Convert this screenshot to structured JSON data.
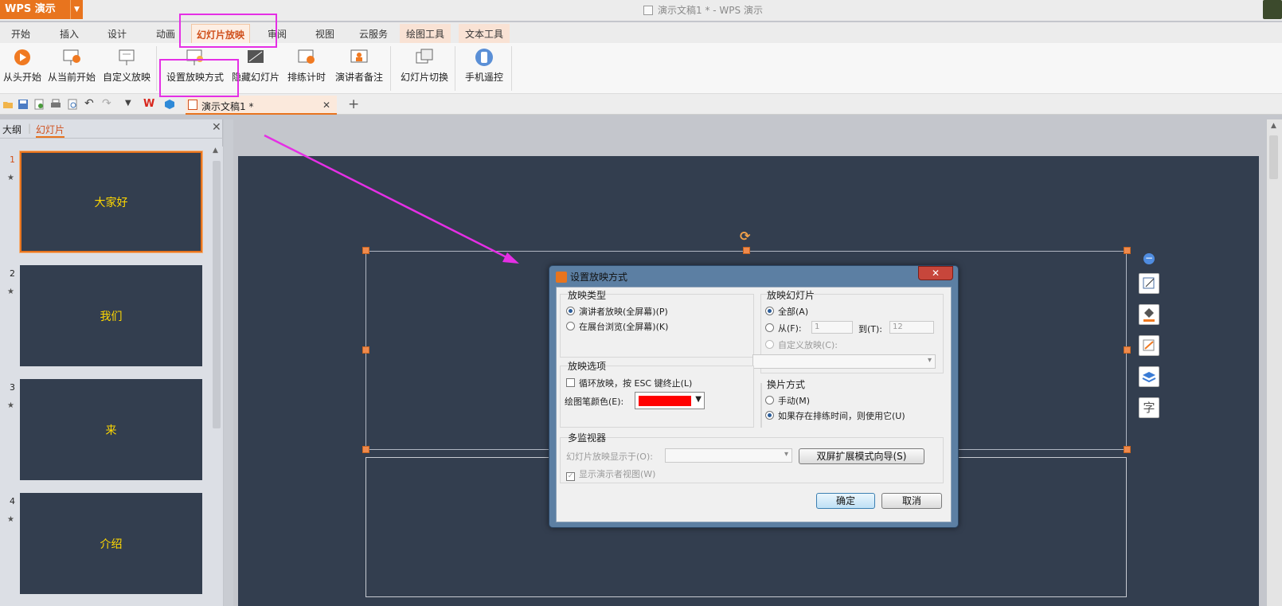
{
  "app": {
    "name": "WPS 演示",
    "window_title": "演示文稿1 * - WPS 演示"
  },
  "menu": [
    "开始",
    "插入",
    "设计",
    "动画",
    "幻灯片放映",
    "审阅",
    "视图",
    "云服务",
    "绘图工具",
    "文本工具"
  ],
  "ribbon": {
    "from_start": "从头开始",
    "from_current": "从当前开始",
    "custom_show": "自定义放映",
    "setup_show": "设置放映方式",
    "hide_slide": "隐藏幻灯片",
    "rehearse": "排练计时",
    "presenter_notes": "演讲者备注",
    "transition": "幻灯片切换",
    "phone_remote": "手机遥控"
  },
  "document_tab": {
    "label": "演示文稿1 *"
  },
  "left_panel": {
    "tab_outline": "大纲",
    "tab_slides": "幻灯片",
    "slides": [
      {
        "num": "1",
        "text": "大家好"
      },
      {
        "num": "2",
        "text": "我们"
      },
      {
        "num": "3",
        "text": "来"
      },
      {
        "num": "4",
        "text": "介绍"
      }
    ]
  },
  "dialog": {
    "title": "设置放映方式",
    "show_type": {
      "label": "放映类型",
      "opt_presenter": "演讲者放映(全屏幕)(P)",
      "opt_kiosk": "在展台浏览(全屏幕)(K)"
    },
    "slides": {
      "label": "放映幻灯片",
      "opt_all": "全部(A)",
      "opt_from": "从(F):",
      "from_value": "1",
      "to_label": "到(T):",
      "to_value": "12",
      "opt_custom": "自定义放映(C):"
    },
    "options": {
      "label": "放映选项",
      "loop": "循环放映，按 ESC 键终止(L)",
      "pen_color": "绘图笔颜色(E):",
      "pen_color_value": "#ff0000"
    },
    "advance": {
      "label": "换片方式",
      "opt_manual": "手动(M)",
      "opt_timings": "如果存在排练时间，则使用它(U)"
    },
    "monitors": {
      "label": "多监视器",
      "display_on": "幻灯片放映显示于(O):",
      "wizard_button": "双屏扩展模式向导(S)",
      "presenter_view": "显示演示者视图(W)"
    },
    "ok": "确定",
    "cancel": "取消"
  },
  "colors": {
    "accent": "#e8741e",
    "slide_bg": "#333e4f",
    "slide_text": "#ffd800",
    "highlight": "#e52fe5"
  }
}
